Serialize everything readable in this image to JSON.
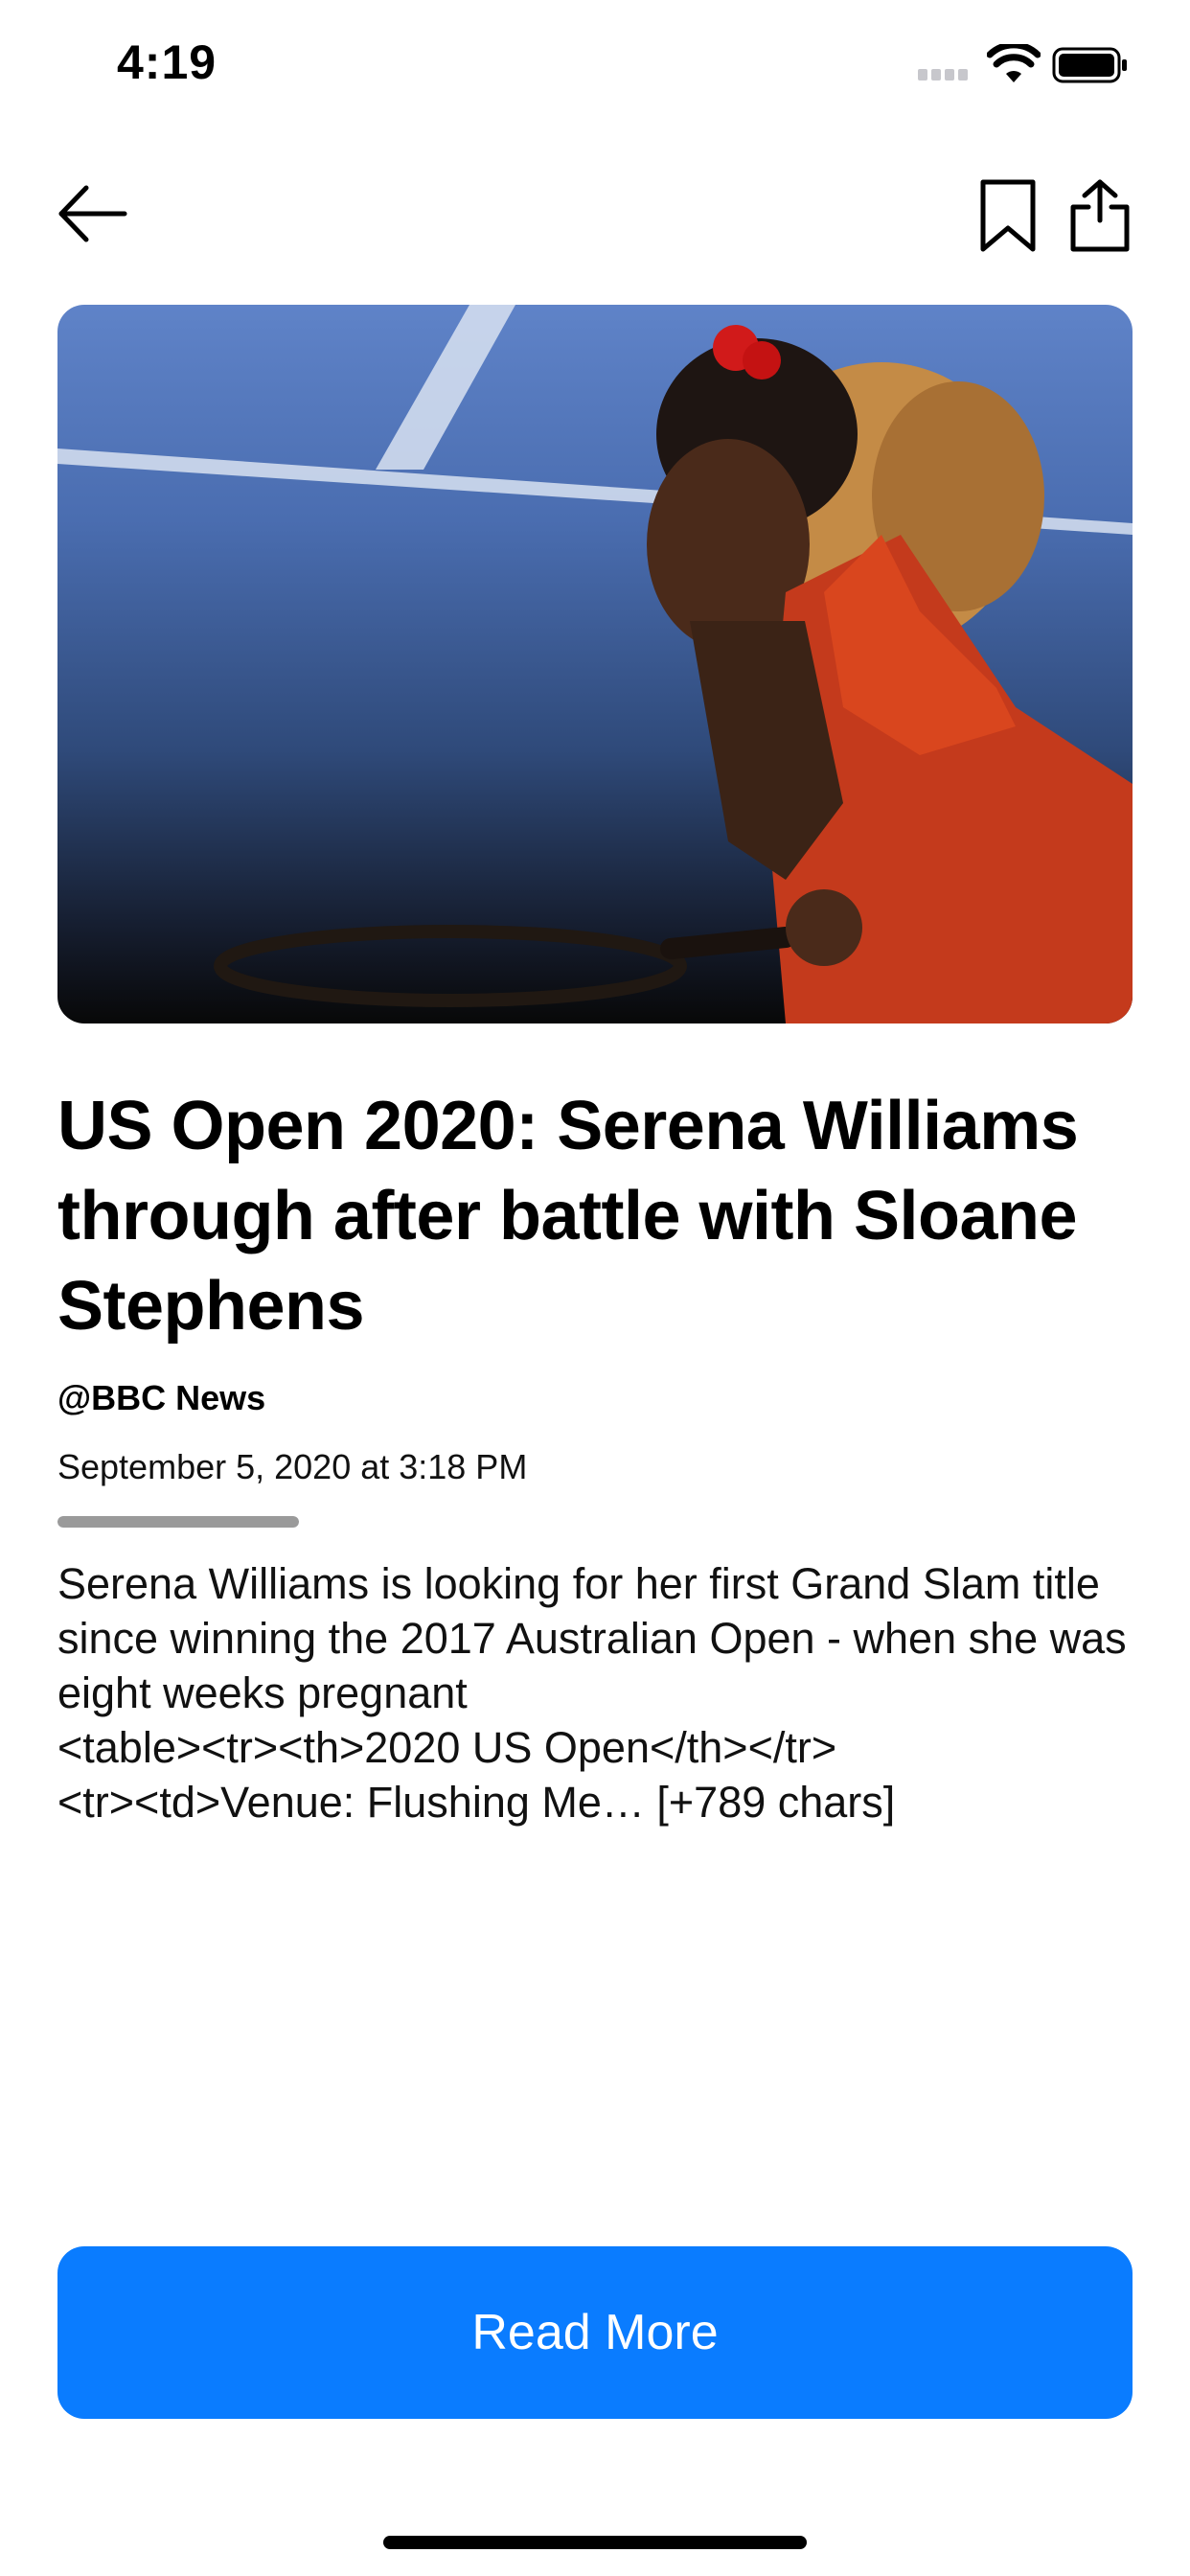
{
  "status_bar": {
    "time": "4:19"
  },
  "nav": {
    "back_icon": "arrow-left-icon",
    "bookmark_icon": "bookmark-icon",
    "share_icon": "share-icon"
  },
  "article": {
    "headline": "US Open 2020: Serena Williams through after battle with Sloane Stephens",
    "source": "@BBC News",
    "date": "September 5, 2020 at 3:18 PM",
    "read_progress": 1.0,
    "body": "Serena Williams is looking for her first Grand Slam title since winning the 2017 Australian Open - when she was eight weeks pregnant\n<table><tr><th>2020 US Open</th></tr>\n<tr><td>Venue: Flushing Me… [+789 chars]"
  },
  "actions": {
    "read_more_label": "Read More"
  },
  "colors": {
    "accent": "#0a7cff",
    "progress": "#9a9a9a"
  }
}
